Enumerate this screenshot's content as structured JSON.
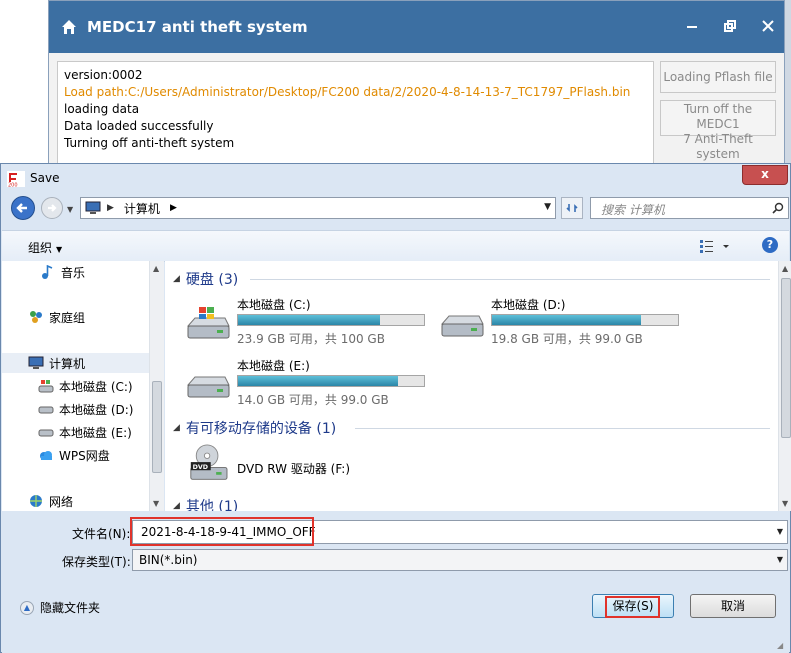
{
  "background_app": {
    "title": "MEDC17 anti theft system",
    "log_lines": [
      "version:0002",
      "Load path:C:/Users/Administrator/Desktop/FC200 data/2/2020-4-8-14-13-7_TC1797_PFlash.bin",
      "loading data",
      "Data loaded successfully",
      "Turning off anti-theft system"
    ],
    "buttons": {
      "load": "Loading Pflash file",
      "turn_off_line1": "Turn off the MEDC1",
      "turn_off_line2": "7 Anti-Theft system"
    }
  },
  "dialog": {
    "title": "Save",
    "address": {
      "path": "计算机",
      "search_placeholder": "搜索 计算机"
    },
    "toolbar": {
      "organize": "组织"
    },
    "nav_items": [
      {
        "label": "音乐",
        "icon": "music-icon"
      },
      {
        "label": "家庭组",
        "icon": "homegroup-icon"
      },
      {
        "label": "计算机",
        "icon": "computer-icon"
      },
      {
        "label": "本地磁盘 (C:)",
        "icon": "drive-c-icon"
      },
      {
        "label": "本地磁盘 (D:)",
        "icon": "drive-icon"
      },
      {
        "label": "本地磁盘 (E:)",
        "icon": "drive-icon"
      },
      {
        "label": "WPS网盘",
        "icon": "cloud-icon"
      },
      {
        "label": "网络",
        "icon": "network-icon"
      }
    ],
    "groups": {
      "hard_disks": "硬盘 (3)",
      "removable": "有可移动存储的设备 (1)",
      "other": "其他 (1)"
    },
    "drives": [
      {
        "name": "本地磁盘 (C:)",
        "free_text": "23.9 GB 可用，共 100 GB",
        "used_fraction": 0.761
      },
      {
        "name": "本地磁盘 (D:)",
        "free_text": "19.8 GB 可用，共 99.0 GB",
        "used_fraction": 0.8
      },
      {
        "name": "本地磁盘 (E:)",
        "free_text": "14.0 GB 可用，共 99.0 GB",
        "used_fraction": 0.859
      }
    ],
    "removable_device": {
      "name": "DVD RW 驱动器 (F:)",
      "icon_label": "DVD"
    },
    "filename_label": "文件名(N):",
    "filename_value": "2021-8-4-18-9-41_IMMO_OFF",
    "filetype_label": "保存类型(T):",
    "filetype_value": "BIN(*.bin)",
    "hide_folders": "隐藏文件夹",
    "save_button": "保存(S)",
    "cancel_button": "取消",
    "close_button": "x"
  },
  "colors": {
    "app_title_bar": "#3c6fa2",
    "log_orange": "#e08a00",
    "highlight_red": "#e0332b",
    "drive_bar": "#2b86a8"
  }
}
